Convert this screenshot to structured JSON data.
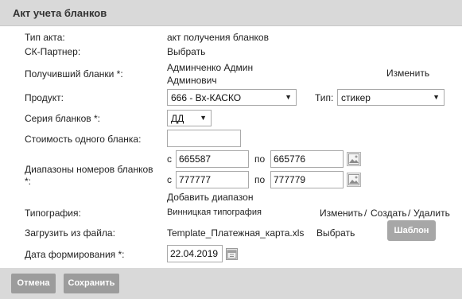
{
  "dialog": {
    "title": "Акт учета бланков"
  },
  "form": {
    "act_type": {
      "label": "Тип акта:",
      "value": "акт получения бланков"
    },
    "partner": {
      "label": "СК-Партнер:",
      "link": "Выбрать"
    },
    "receiver": {
      "label": "Получивший бланки *:",
      "name_line1": "Админченко Админ",
      "name_line2": "Админович",
      "change": "Изменить"
    },
    "product": {
      "label": "Продукт:",
      "selected": "666 - Вх-КАСКО"
    },
    "type": {
      "label": "Тип:",
      "selected": "стикер"
    },
    "series": {
      "label": "Серия бланков *:",
      "selected": "ДД"
    },
    "cost": {
      "label": "Стоимость одного бланка:",
      "value": ""
    },
    "ranges": {
      "label_line1": "Диапазоны номеров бланков",
      "label_line2": "*:",
      "from_label": "с",
      "to_label": "по",
      "rows": [
        {
          "from": "665587",
          "to": "665776"
        },
        {
          "from": "777777",
          "to": "777779"
        }
      ],
      "add": "Добавить диапазон"
    },
    "typography": {
      "label": "Типография:",
      "value": "Винницкая типография",
      "change": "Изменить",
      "sep1": "/",
      "create": "Создать",
      "sep2": "/",
      "delete": "Удалить"
    },
    "upload": {
      "label": "Загрузить из файла:",
      "file": "Template_Платежная_карта.xls",
      "choose": "Выбрать",
      "template_button": "Шаблон"
    },
    "date": {
      "label": "Дата формирования *:",
      "value": "22.04.2019"
    }
  },
  "footer": {
    "cancel": "Отмена",
    "save": "Сохранить"
  },
  "icons": {
    "dropdown": "chevron-down-icon",
    "image": "image-icon",
    "calendar": "calendar-icon"
  }
}
